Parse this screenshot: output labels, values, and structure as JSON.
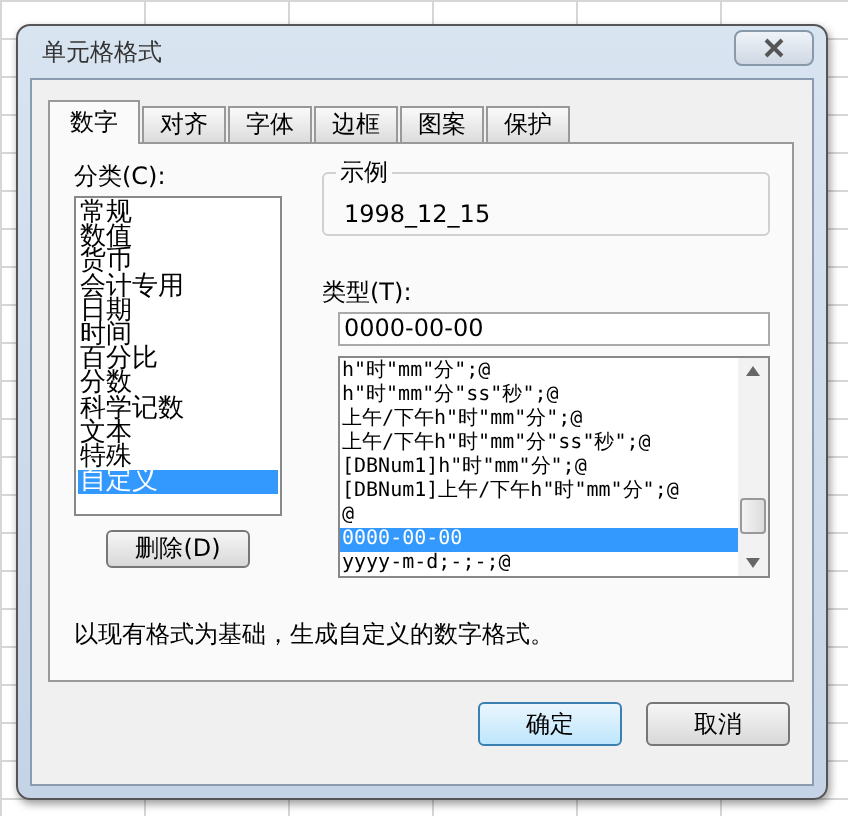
{
  "window": {
    "title": "单元格格式"
  },
  "tabs": [
    {
      "label": "数字",
      "selected": true
    },
    {
      "label": "对齐",
      "selected": false
    },
    {
      "label": "字体",
      "selected": false
    },
    {
      "label": "边框",
      "selected": false
    },
    {
      "label": "图案",
      "selected": false
    },
    {
      "label": "保护",
      "selected": false
    }
  ],
  "category": {
    "label": "分类(C):",
    "items": [
      {
        "label": "常规",
        "selected": false
      },
      {
        "label": "数值",
        "selected": false
      },
      {
        "label": "货币",
        "selected": false
      },
      {
        "label": "会计专用",
        "selected": false
      },
      {
        "label": "日期",
        "selected": false
      },
      {
        "label": "时间",
        "selected": false
      },
      {
        "label": "百分比",
        "selected": false
      },
      {
        "label": "分数",
        "selected": false
      },
      {
        "label": "科学记数",
        "selected": false
      },
      {
        "label": "文本",
        "selected": false
      },
      {
        "label": "特殊",
        "selected": false
      },
      {
        "label": "自定义",
        "selected": true
      }
    ]
  },
  "delete_button": "删除(D)",
  "sample": {
    "label": "示例",
    "value": "1998_12_15"
  },
  "type": {
    "label": "类型(T):",
    "value": "0000-00-00",
    "formats": [
      {
        "label": "h\"时\"mm\"分\";@",
        "selected": false
      },
      {
        "label": "h\"时\"mm\"分\"ss\"秒\";@",
        "selected": false
      },
      {
        "label": "上午/下午h\"时\"mm\"分\";@",
        "selected": false
      },
      {
        "label": "上午/下午h\"时\"mm\"分\"ss\"秒\";@",
        "selected": false
      },
      {
        "label": "[DBNum1]h\"时\"mm\"分\";@",
        "selected": false
      },
      {
        "label": "[DBNum1]上午/下午h\"时\"mm\"分\";@",
        "selected": false
      },
      {
        "label": "@",
        "selected": false
      },
      {
        "label": "0000-00-00",
        "selected": true
      },
      {
        "label": "yyyy-m-d;-;-;@",
        "selected": false
      }
    ]
  },
  "description": "以现有格式为基础，生成自定义的数字格式。",
  "buttons": [
    {
      "label": "确定",
      "kind": "default"
    },
    {
      "label": "取消",
      "kind": "normal"
    }
  ]
}
